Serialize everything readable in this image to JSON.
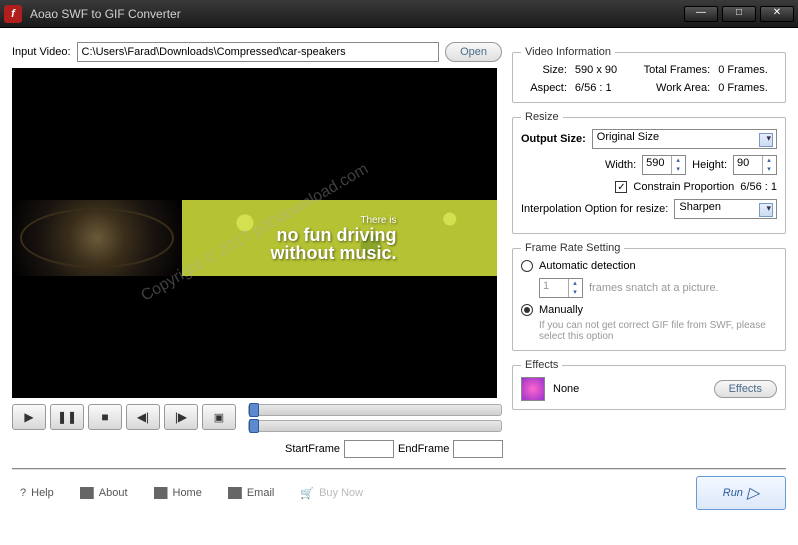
{
  "window": {
    "title": "Aoao SWF to GIF Converter"
  },
  "input": {
    "label": "Input Video:",
    "path": "C:\\Users\\Farad\\Downloads\\Compressed\\car-speakers",
    "open_btn": "Open"
  },
  "banner": {
    "line1": "There is",
    "line2": "no fun driving",
    "line3": "without music."
  },
  "watermark": "Copyright © 2017 p30download.com",
  "controls": {
    "startframe_label": "StartFrame",
    "startframe_val": "",
    "endframe_label": "EndFrame",
    "endframe_val": ""
  },
  "video_info": {
    "legend": "Video Information",
    "size_label": "Size:",
    "size_value": "590 x 90",
    "total_label": "Total Frames:",
    "total_value": "0 Frames.",
    "aspect_label": "Aspect:",
    "aspect_value": "6/56 : 1",
    "work_label": "Work Area:",
    "work_value": "0 Frames."
  },
  "resize": {
    "legend": "Resize",
    "output_label": "Output Size:",
    "output_value": "Original Size",
    "width_label": "Width:",
    "width_value": "590",
    "height_label": "Height:",
    "height_value": "90",
    "constrain_label": "Constrain Proportion",
    "constrain_ratio": "6/56 : 1",
    "interp_label": "Interpolation Option for resize:",
    "interp_value": "Sharpen"
  },
  "framerate": {
    "legend": "Frame Rate Setting",
    "auto_label": "Automatic detection",
    "snatch_val": "1",
    "snatch_label": "frames snatch at a picture.",
    "manual_label": "Manually",
    "manual_hint": "If you can not get correct GIF file from SWF, please select this option"
  },
  "effects": {
    "legend": "Effects",
    "none_label": "None",
    "btn": "Effects"
  },
  "footer": {
    "help": "Help",
    "about": "About",
    "home": "Home",
    "email": "Email",
    "buy": "Buy Now",
    "run": "Run"
  }
}
